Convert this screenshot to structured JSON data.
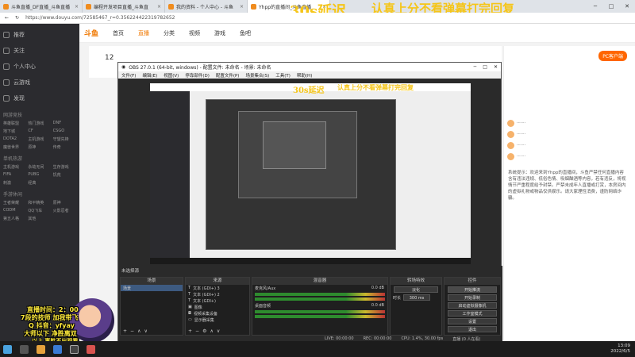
{
  "browser": {
    "tabs": [
      {
        "label": "斗鱼直播_DF直播_斗鱼直播",
        "active": false
      },
      {
        "label": "编程开发项目直播_斗鱼直",
        "active": false
      },
      {
        "label": "我的资料 - 个人中心 - 斗鱼",
        "active": false
      },
      {
        "label": "Yhpp的直播间_斗鱼直播",
        "active": true
      },
      {
        "label": "",
        "active": false
      }
    ],
    "url": "https://www.douyu.com/72585467_r=0.356224422319782652",
    "overlay_text_1": "30s延迟",
    "overlay_text_2": "认真上分不看弹幕打完回复"
  },
  "site": {
    "nav": [
      "首页",
      "直播",
      "分类",
      "视频",
      "游戏",
      "鱼吧"
    ],
    "hot_index": 1,
    "left_nav": [
      "推荐",
      "关注",
      "个人中心",
      "云游戏",
      "发现"
    ],
    "left_section_1": "网游竞技",
    "left_grid_1": [
      "英雄联盟",
      "热门游戏",
      "DNF",
      "地下城",
      "CF",
      "CSGO",
      "DOTA2",
      "主机游戏",
      "守望先锋",
      "魔兽世界",
      "原神",
      "传奇"
    ],
    "left_section_2": "单机热游",
    "left_grid_2": [
      "主机游戏",
      "永劫无间",
      "生存游戏",
      "FIFA",
      "PUBG",
      "饥荒",
      "刺激",
      "经典"
    ],
    "left_section_3": "手游休闲",
    "left_grid_3": [
      "王者荣耀",
      "和平精英",
      "原神",
      "CODM",
      "QQ飞车",
      "火影忍者",
      "第五人格",
      "其他"
    ],
    "room_number": "12",
    "pcb_label": "PC客户端",
    "chat_text": "系统提示：欢迎来到Yhpp的直播间，斗鱼严禁任何直播内容含有违法违规、低俗色情、吸烟酗酒等内容，若有违反，将视情节严重程度给予封禁。严禁未成年人直播或打赏，本房间内的虚拟礼物或物品仅供娱乐。请大家理性消费，谨防网络诈骗。"
  },
  "obs": {
    "title": "OBS 27.0.1 (64-bit, windows) - 配置文件: 未命名 - 场景: 未命名",
    "menu": [
      "文件(F)",
      "编辑(E)",
      "视图(V)",
      "停靠部件(D)",
      "配置文件(P)",
      "场景集合(S)",
      "工具(T)",
      "帮助(H)"
    ],
    "scene_label": "未选择源",
    "panels": {
      "scenes": "场景",
      "sources": "来源",
      "mixer": "混音器",
      "transitions": "转场特效",
      "controls": "控件"
    },
    "scene_items": [
      "场景"
    ],
    "sources": [
      "文本 (GDI+) 3",
      "文本 (GDI+) 2",
      "文本 (GDI+)",
      "图像",
      "视频采集设备",
      "显示器采集"
    ],
    "mixer": [
      {
        "name": "麦克风/Aux",
        "level": "0.0 dB"
      },
      {
        "name": "桌面音频",
        "level": "0.0 dB"
      }
    ],
    "transition": "淡化",
    "duration_label": "时长",
    "duration_value": "300 ms",
    "controls": [
      "开始推流",
      "开始录制",
      "启动虚拟摄像机",
      "工作室模式",
      "设置",
      "退出"
    ],
    "status": [
      "LIVE: 00:00:00",
      "REC: 00:00:00",
      "CPU: 1.4%, 30.00 fps",
      "直播 (0 人在看)"
    ]
  },
  "danmaku": [
    "直播时间：2：00",
    "7段的技师 加我带飞",
    "Q 抖音：yfyay",
    "大师以下 净胜离双",
    "以上 离胜不出观看"
  ],
  "taskbar": {
    "time": "13:09",
    "date": "2022/6/5"
  },
  "colors": {
    "accent": "#f07800",
    "overlay": "#f5c518",
    "obs_bg": "#2a2a2a"
  }
}
